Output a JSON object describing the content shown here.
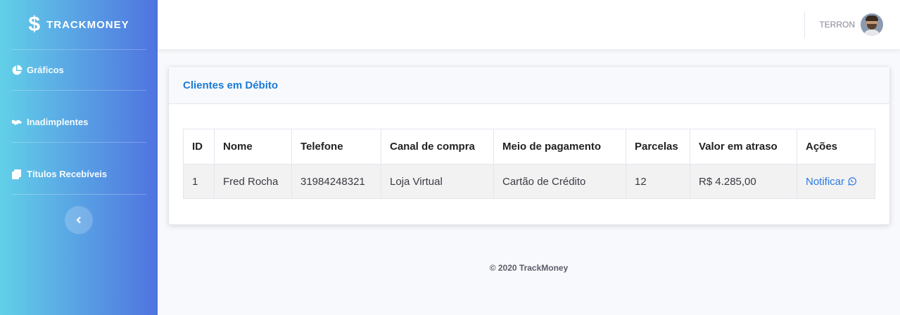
{
  "brand": {
    "logo_glyph": "$",
    "name": "TRACKMONEY"
  },
  "sidebar": {
    "items": [
      {
        "label": "Gráficos",
        "icon": "pie-chart-icon"
      },
      {
        "label": "Inadimplentes",
        "icon": "handshake-icon"
      },
      {
        "label": "Títulos Recebíveis",
        "icon": "copy-icon"
      }
    ],
    "toggle_icon": "chevron-left-icon"
  },
  "topbar": {
    "username": "TERRON",
    "avatar_icon": "user-avatar"
  },
  "card": {
    "title": "Clientes em Débito",
    "columns": [
      "ID",
      "Nome",
      "Telefone",
      "Canal de compra",
      "Meio de pagamento",
      "Parcelas",
      "Valor em atraso",
      "Ações"
    ],
    "rows": [
      {
        "id": "1",
        "nome": "Fred Rocha",
        "telefone": "31984248321",
        "canal": "Loja Virtual",
        "meio": "Cartão de Crédito",
        "parcelas": "12",
        "valor": "R$ 4.285,00",
        "acao": "Notificar",
        "acao_icon": "whatsapp-icon"
      }
    ]
  },
  "footer": {
    "text": "© 2020 TrackMoney"
  },
  "colors": {
    "sidebar_start": "#62d0e8",
    "sidebar_end": "#4f73e0",
    "accent": "#1a7ad6"
  }
}
